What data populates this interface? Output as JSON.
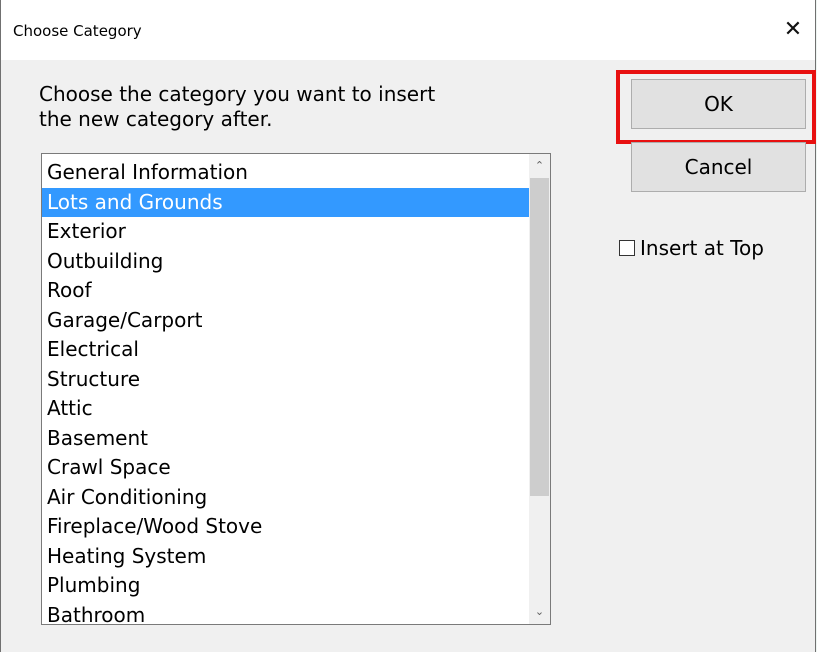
{
  "window": {
    "title": "Choose Category",
    "close_glyph": "✕"
  },
  "prompt": {
    "line1": "Choose the category you want to insert",
    "line2": "the new category after."
  },
  "list": {
    "items": [
      "General Information",
      "Lots and Grounds",
      "Exterior",
      "Outbuilding",
      "Roof",
      "Garage/Carport",
      "Electrical",
      "Structure",
      "Attic",
      "Basement",
      "Crawl Space",
      "Air Conditioning",
      "Fireplace/Wood Stove",
      "Heating System",
      "Plumbing",
      "Bathroom"
    ],
    "selected_index": 1
  },
  "buttons": {
    "ok_label": "OK",
    "cancel_label": "Cancel"
  },
  "options": {
    "insert_at_top_label": "Insert at Top",
    "insert_at_top_checked": false
  },
  "icons": {
    "scroll_up": "chevron-up-icon",
    "scroll_down": "chevron-down-icon",
    "close": "close-icon"
  },
  "colors": {
    "selection": "#3399ff",
    "highlight_box": "#e81010"
  }
}
